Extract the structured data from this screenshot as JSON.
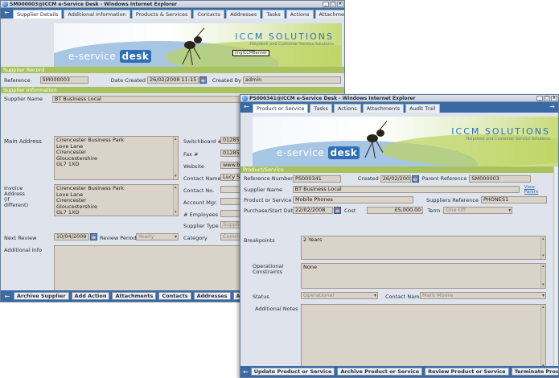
{
  "win1": {
    "title": "SM000003@ICCM e-Service Desk - Windows Internet Explorer",
    "tabs": [
      "Supplier Details",
      "Additional Information",
      "Products & Services",
      "Contacts",
      "Addresses",
      "Tasks",
      "Actions",
      "Attachments"
    ],
    "banner": {
      "logo_pre": "e-service",
      "logo_box": "desk",
      "brand": "ICCM SOLUTIONS",
      "brand_sub": "Helpdesk and Customer Service Solutions",
      "tooltip": "imgICCMBanner"
    },
    "section_record": "Supplier Record",
    "reference_label": "Reference",
    "reference": "SM000003",
    "date_created_label": "Date Created",
    "date_created": "26/02/2008 11:15",
    "created_by_label": "Created By",
    "created_by": "admin",
    "section_info": "Supplier Information",
    "supplier_name_label": "Supplier Name",
    "supplier_name": "BT Business Local",
    "main_address_label": "Main Address",
    "main_address": "Cirencester Business Park\nLove Lane\nCirencester\nGloucestershire\nGL7 1XD",
    "switchboard_label": "Switchboard #",
    "switchboard": "01285 6",
    "fax_label": "Fax #",
    "fax": "01285 6",
    "website_label": "Website",
    "website": "www.bt",
    "contact_name_label": "Contact Name",
    "contact_name": "Lucy Sh",
    "invoice_address_label": "Invoice\nAddress\n(if\ndifferent)",
    "invoice_address": "Cirencester Business Park\nLove Lane\nCirencester\nGloucestershire\nGL7 1XD",
    "contact_no_label": "Contact No.",
    "account_mgr_label": "Account Mgr.",
    "employees_label": "# Employees",
    "supplier_type_label": "Supplier Type",
    "supplier_type": "Supplie",
    "next_review_label": "Next Review",
    "next_review": "10/04/2009",
    "review_period_label": "Review Period",
    "review_period": "Yearly",
    "category_label": "Category",
    "category": "Comm",
    "additional_info_label": "Additional Info",
    "footer_buttons": [
      "Archive Supplier",
      "Add Action",
      "Attachments",
      "Contacts",
      "Addresses",
      "Additio"
    ]
  },
  "win2": {
    "title": "PS000341@ICCM e-Service Desk - Windows Internet Explorer",
    "tabs": [
      "Product or Service",
      "Tasks",
      "Actions",
      "Attachments",
      "Audit Trail"
    ],
    "banner": {
      "logo_pre": "e-service",
      "logo_box": "desk",
      "brand": "ICCM SOLUTIONS",
      "brand_sub": "Helpdesk and Customer Service Solutions"
    },
    "section": "Product/Service",
    "reference_number_label": "Reference Number",
    "reference_number": "PS000341",
    "created_label": "Created",
    "created": "26/02/2008",
    "parent_reference_label": "Parent Reference",
    "parent_reference": "SM000003",
    "supplier_name_label": "Supplier Name",
    "supplier_name": "BT Business Local",
    "view_parent": "View Parent",
    "product_label": "Product or Service",
    "product": "Mobile Phones",
    "suppliers_reference_label": "Suppliers Reference",
    "suppliers_reference": "PHONES1",
    "purchase_label": "Purchase/Start Date",
    "purchase_date": "22/02/2008",
    "cost_label": "Cost",
    "cost": "£5,000.00",
    "term_label": "Term",
    "term": "One Off",
    "breakpoints_label": "Breakpoints",
    "breakpoints": "2 Years",
    "constraints_label": "Operational\nConstraints",
    "constraints": "None",
    "status_label": "Status",
    "status": "Operational",
    "contact_name_label": "Contact Name",
    "contact_name": "Mark Moore",
    "notes_label": "Additional Notes",
    "footer_buttons": [
      "Update Product or Service",
      "Archive Product or Service",
      "Review Product or Service",
      "Terminate Product or Ser"
    ]
  },
  "icons": {
    "calendar": "calendar-icon",
    "back": "back-arrow-icon",
    "forward": "forward-arrow-icon"
  }
}
